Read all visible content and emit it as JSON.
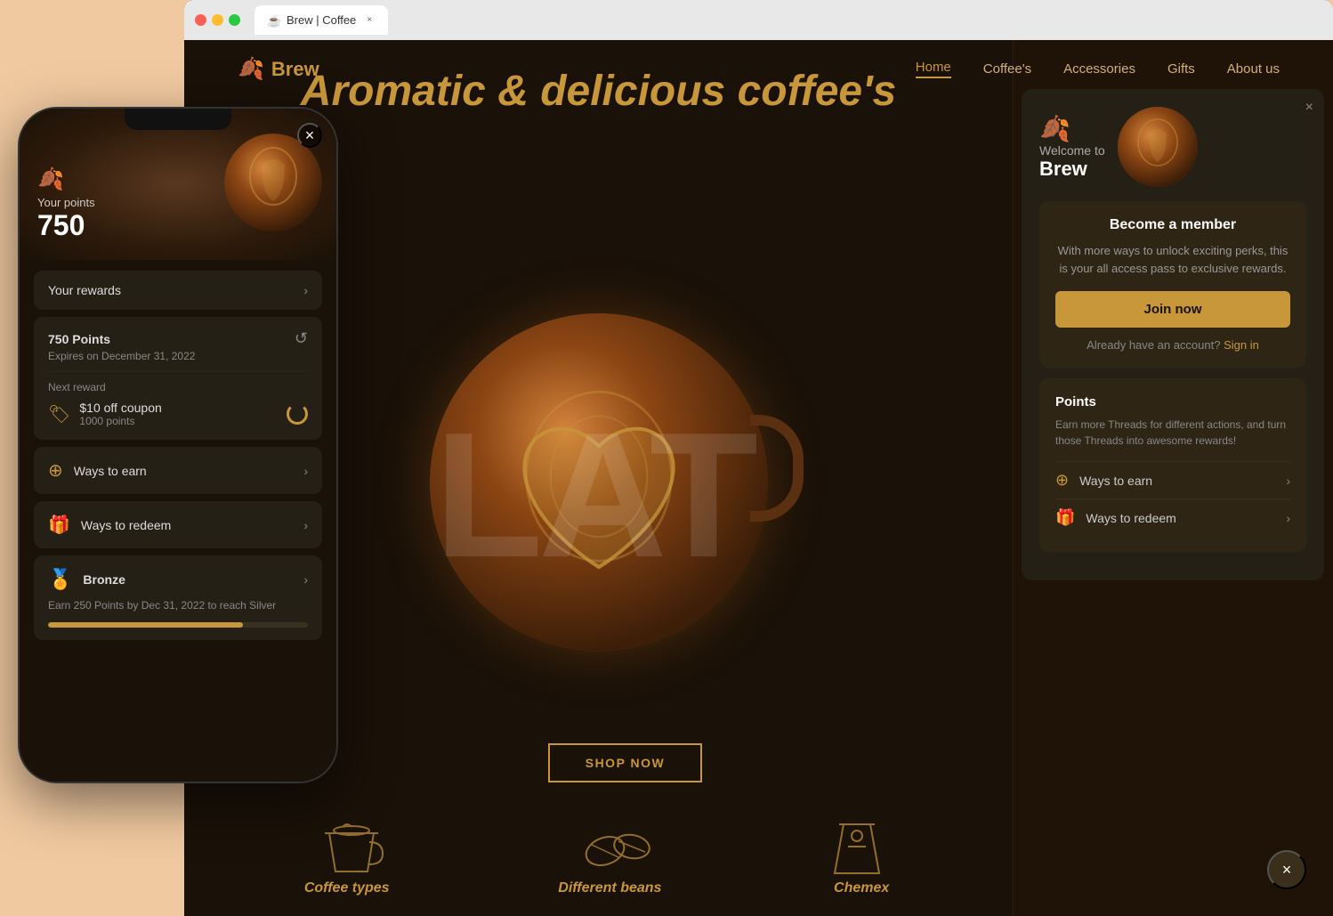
{
  "browser": {
    "tab_title": "Brew | Coffee",
    "tab_favicon": "☕",
    "close_label": "×"
  },
  "nav": {
    "logo": "Brew",
    "logo_icon": "🍂",
    "links": [
      {
        "label": "Home",
        "active": true
      },
      {
        "label": "Coffee's",
        "active": false
      },
      {
        "label": "Accessories",
        "active": false
      },
      {
        "label": "Gifts",
        "active": false
      },
      {
        "label": "About us",
        "active": false
      }
    ]
  },
  "hero": {
    "title": "Aromatic & delicious coffee's",
    "big_text": "LAT",
    "shop_button": "SHOP NOW"
  },
  "slide_dots": [
    "active",
    "inactive",
    "inactive",
    "inactive"
  ],
  "bottom_categories": [
    {
      "label": "Coffee types",
      "icon": "cup"
    },
    {
      "label": "Different beans",
      "icon": "beans"
    },
    {
      "label": "Chemex",
      "icon": "chemex"
    }
  ],
  "membership_panel": {
    "close": "×",
    "welcome": "Welcome to",
    "brand": "Brew",
    "become_member": {
      "title": "Become a member",
      "description": "With more ways to unlock exciting perks, this is your all access pass to exclusive rewards.",
      "join_button": "Join now",
      "sign_in_text": "Already have an account?",
      "sign_in_link": "Sign in"
    },
    "points": {
      "title": "Points",
      "description": "Earn more Threads for different actions, and turn those Threads into awesome rewards!",
      "ways_to_earn": "Ways to earn",
      "ways_to_redeem": "Ways to redeem"
    }
  },
  "phone": {
    "close": "×",
    "flame_icon": "🍂",
    "points_label": "Your points",
    "points_value": "750",
    "rewards_label": "Your rewards",
    "points_section": {
      "points": "750 Points",
      "expires": "Expires on December 31, 2022",
      "next_reward": "Next reward",
      "coupon_name": "$10 off coupon",
      "coupon_points": "1000 points"
    },
    "ways_to_earn": "Ways to earn",
    "ways_to_redeem": "Ways to redeem",
    "bronze": {
      "label": "Bronze",
      "description": "Earn 250 Points by Dec 31, 2022 to reach Silver",
      "progress": 75
    }
  },
  "floating_close": "×",
  "colors": {
    "accent": "#c8973a",
    "bg_dark": "#1a1108",
    "bg_card": "#252015",
    "text_secondary": "#888"
  }
}
